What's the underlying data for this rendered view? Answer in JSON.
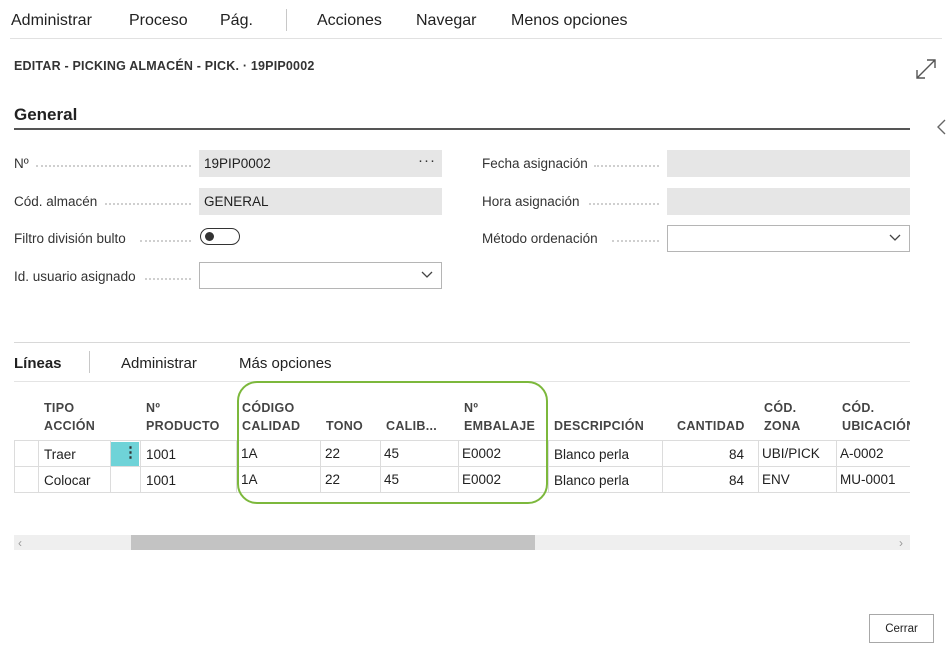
{
  "menu": {
    "items": [
      "Administrar",
      "Proceso",
      "Pág.",
      "Acciones",
      "Navegar",
      "Menos opciones"
    ]
  },
  "page": {
    "title": "EDITAR - PICKING ALMACÉN - PICK. · 19PIP0002"
  },
  "general": {
    "title": "General",
    "fields": {
      "no_label": "Nº",
      "no_value": "19PIP0002",
      "almacen_label": "Cód. almacén",
      "almacen_value": "GENERAL",
      "filtro_label": "Filtro división bulto",
      "usuario_label": "Id. usuario asignado",
      "usuario_value": "",
      "fecha_label": "Fecha asignación",
      "fecha_value": "",
      "hora_label": "Hora asignación",
      "hora_value": "",
      "metodo_label": "Método ordenación",
      "metodo_value": ""
    },
    "filtro_toggle_on": false
  },
  "lines": {
    "tabs": [
      "Líneas",
      "Administrar",
      "Más opciones"
    ],
    "headers": {
      "tipo_accion": [
        "TIPO",
        "ACCIÓN"
      ],
      "n_producto": [
        "Nº",
        "PRODUCTO"
      ],
      "codigo_calidad": [
        "CÓDIGO",
        "CALIDAD"
      ],
      "tono": "TONO",
      "calibre": "CALIB...",
      "n_embalaje": [
        "Nº",
        "EMBALAJE"
      ],
      "descripcion": "DESCRIPCIÓN",
      "cantidad": "CANTIDAD",
      "cod_zona": [
        "CÓD.",
        "ZONA"
      ],
      "cod_ubicacion": [
        "CÓD.",
        "UBICACIÓN"
      ]
    },
    "rows": [
      {
        "tipo": "Traer",
        "producto": "1001",
        "calidad": "1A",
        "tono": "22",
        "calibre": "45",
        "embalaje": "E0002",
        "descripcion": "Blanco perla",
        "cantidad": "84",
        "zona": "UBI/PICK",
        "ubicacion": "A-0002"
      },
      {
        "tipo": "Colocar",
        "producto": "1001",
        "calidad": "1A",
        "tono": "22",
        "calibre": "45",
        "embalaje": "E0002",
        "descripcion": "Blanco perla",
        "cantidad": "84",
        "zona": "ENV",
        "ubicacion": "MU-0001"
      }
    ],
    "highlight_color": "#7cb83c",
    "selected_row_menu_color": "#6fd3d8"
  },
  "icons": {
    "expand": "expand-icon",
    "collapse": "chevron-left-icon",
    "dropdown": "chevron-down-icon",
    "more": "ellipsis-icon",
    "row_menu": "vertical-dots-icon"
  },
  "footer": {
    "close_label": "Cerrar"
  }
}
